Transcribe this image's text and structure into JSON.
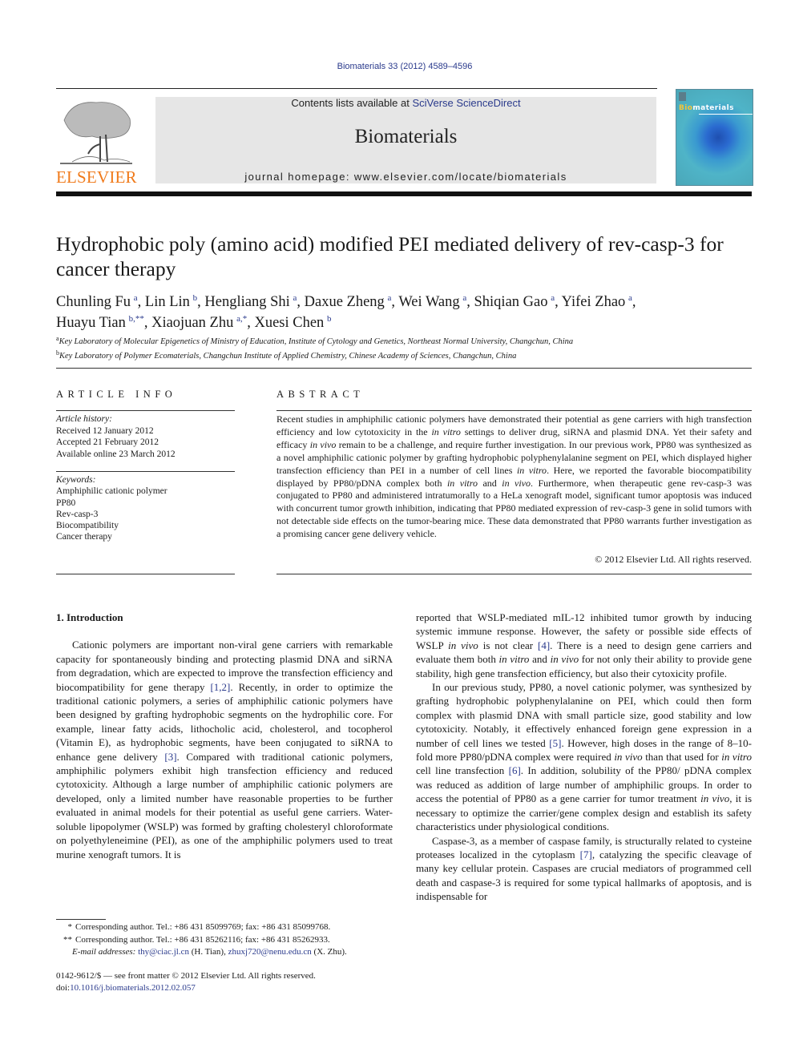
{
  "header": {
    "citation": "Biomaterials 33 (2012) 4589–4596",
    "contents_prefix": "Contents lists available at ",
    "contents_link": "SciVerse ScienceDirect",
    "journal_name": "Biomaterials",
    "homepage": "journal homepage: www.elsevier.com/locate/biomaterials",
    "publisher_logo_text": "ELSEVIER",
    "cover_title_prefix": "Bio",
    "cover_title_suffix": "materials",
    "colors": {
      "publisher_orange": "#f07a1a",
      "link_blue": "#2a3a8c",
      "banner_gray": "#e6e6e6"
    }
  },
  "article": {
    "title": "Hydrophobic poly (amino acid) modified PEI mediated delivery of rev-casp-3 for cancer therapy",
    "authors": [
      {
        "name": "Chunling Fu",
        "sup": "a",
        "sep": ", "
      },
      {
        "name": "Lin Lin",
        "sup": "b",
        "sep": ", "
      },
      {
        "name": "Hengliang Shi",
        "sup": "a",
        "sep": ", "
      },
      {
        "name": "Daxue Zheng",
        "sup": "a",
        "sep": ", "
      },
      {
        "name": "Wei Wang",
        "sup": "a",
        "sep": ", "
      },
      {
        "name": "Shiqian Gao",
        "sup": "a",
        "sep": ", "
      },
      {
        "name": "Yifei Zhao",
        "sup": "a",
        "sep": ","
      },
      {
        "name": "Huayu Tian",
        "sup": "b,**",
        "sep": ", "
      },
      {
        "name": "Xiaojuan Zhu",
        "sup": "a,*",
        "sep": ", "
      },
      {
        "name": "Xuesi Chen",
        "sup": "b",
        "sep": ""
      }
    ],
    "affiliations": [
      {
        "mark": "a",
        "text": "Key Laboratory of Molecular Epigenetics of Ministry of Education, Institute of Cytology and Genetics, Northeast Normal University, Changchun, China"
      },
      {
        "mark": "b",
        "text": "Key Laboratory of Polymer Ecomaterials, Changchun Institute of Applied Chemistry, Chinese Academy of Sciences, Changchun, China"
      }
    ]
  },
  "article_info": {
    "heading": "ARTICLE INFO",
    "history_label": "Article history:",
    "history": [
      "Received 12 January 2012",
      "Accepted 21 February 2012",
      "Available online 23 March 2012"
    ],
    "keywords_label": "Keywords:",
    "keywords": [
      "Amphiphilic cationic polymer",
      "PP80",
      "Rev-casp-3",
      "Biocompatibility",
      "Cancer therapy"
    ]
  },
  "abstract": {
    "heading": "ABSTRACT",
    "segments": [
      {
        "t": "Recent studies in amphiphilic cationic polymers have demonstrated their potential as gene carriers with high transfection efficiency and low cytotoxicity in the "
      },
      {
        "t": "in vitro",
        "i": true
      },
      {
        "t": " settings to deliver drug, siRNA and plasmid DNA. Yet their safety and efficacy "
      },
      {
        "t": "in vivo",
        "i": true
      },
      {
        "t": " remain to be a challenge, and require further investigation. In our previous work, PP80 was synthesized as a novel amphiphilic cationic polymer by grafting hydro­phobic polyphenylalanine segment on PEI, which displayed higher transfection efficiency than PEI in a number of cell lines "
      },
      {
        "t": "in vitro",
        "i": true
      },
      {
        "t": ". Here, we reported the favorable biocompatibility displayed by PP80/pDNA complex both "
      },
      {
        "t": "in vitro",
        "i": true
      },
      {
        "t": " and "
      },
      {
        "t": "in vivo",
        "i": true
      },
      {
        "t": ". Furthermore, when therapeutic gene rev-casp-3 was conjugated to PP80 and administered intratumorally to a HeLa xenograft model, significant tumor apoptosis was induced with concurrent tumor growth inhibition, indicating that PP80 mediated expression of rev-casp-3 gene in solid tumors with not detectable side effects on the tumor-bearing mice. These data demon­strated that PP80 warrants further investigation as a promising cancer gene delivery vehicle."
      }
    ],
    "copyright": "© 2012 Elsevier Ltd. All rights reserved."
  },
  "body": {
    "section_heading": "1.  Introduction",
    "left_paragraphs": [
      {
        "indent": true,
        "segments": [
          {
            "t": "Cationic polymers are important non-viral gene carriers with remarkable capacity for spontaneously binding and protecting plasmid DNA and siRNA from degradation, which are expected to improve the transfection efficiency and biocompatibility for gene therapy "
          },
          {
            "t": "[1,2]",
            "link": true
          },
          {
            "t": ". Recently, in order to optimize the traditional cationic polymers, a series of amphiphilic cationic polymers have been designed by grafting hydrophobic segments on the hydrophilic core. For example, linear fatty acids, lithocholic acid, cholesterol, and tocopherol (Vitamin E), as hydrophobic segments, have been conjugated to siRNA to enhance gene delivery "
          },
          {
            "t": "[3]",
            "link": true
          },
          {
            "t": ". Compared with traditional cationic polymers, amphiphilic polymers exhibit high transfection efficiency and reduced cytotoxicity. Although a large number of amphiphilic cationic polymers are developed, only a limited number have reasonable properties to be further evalu­ated in animal models for their potential as useful gene carriers. Water-soluble lipopolymer (WSLP) was formed by grafting cho­lesteryl chloroformate on polyethyleneimine (PEI), as one of the amphiphilic polymers used to treat murine xenograft tumors. It is"
          }
        ]
      }
    ],
    "right_paragraphs": [
      {
        "indent": false,
        "segments": [
          {
            "t": "reported that WSLP-mediated mIL-12 inhibited tumor growth by inducing systemic immune response. However, the safety or possible side effects of WSLP "
          },
          {
            "t": "in vivo",
            "i": true
          },
          {
            "t": " is not clear "
          },
          {
            "t": "[4]",
            "link": true
          },
          {
            "t": ". There is a need to design gene carriers and evaluate them both "
          },
          {
            "t": "in vitro",
            "i": true
          },
          {
            "t": " and "
          },
          {
            "t": "in vivo",
            "i": true
          },
          {
            "t": " for not only their ability to provide gene stability, high gene transfection efficiency, but also their cytoxicity profile."
          }
        ]
      },
      {
        "indent": true,
        "segments": [
          {
            "t": "In our previous study, PP80, a novel cationic polymer, was synthesized by grafting hydrophobic polyphenylalanine on PEI, which could then form complex with plasmid DNA with small particle size, good stability and low cytotoxicity. Notably, it effec­tively enhanced foreign gene expression in a number of cell lines we tested "
          },
          {
            "t": "[5]",
            "link": true
          },
          {
            "t": ". However, high doses in the range of 8–10-fold more PP80/pDNA complex were required "
          },
          {
            "t": "in vivo",
            "i": true
          },
          {
            "t": " than that used for "
          },
          {
            "t": "in vitro",
            "i": true
          },
          {
            "t": " cell line transfection "
          },
          {
            "t": "[6]",
            "link": true
          },
          {
            "t": ". In addition, solubility of the PP80/ pDNA complex was reduced as addition of large number of amphiphilic groups. In order to access the potential of PP80 as a gene carrier for tumor treatment "
          },
          {
            "t": "in vivo",
            "i": true
          },
          {
            "t": ", it is necessary to opti­mize the carrier/gene complex design and establish its safety characteristics under physiological conditions."
          }
        ]
      },
      {
        "indent": true,
        "segments": [
          {
            "t": "Caspase-3, as a member of caspase family, is structurally related to cysteine proteases localized in the cytoplasm "
          },
          {
            "t": "[7]",
            "link": true
          },
          {
            "t": ", catalyzing the specific cleavage of many key cellular protein. Caspases are crucial mediators of programmed cell death and caspase-3 is required for some typical hallmarks of apoptosis, and is indispensable for"
          }
        ]
      }
    ]
  },
  "footnotes": {
    "corresponding": [
      {
        "mark": "*",
        "text": "Corresponding author. Tel.: +86 431 85099769; fax: +86 431 85099768."
      },
      {
        "mark": "**",
        "text": "Corresponding author. Tel.: +86 431 85262116; fax: +86 431 85262933."
      }
    ],
    "email_label": "E-mail addresses:",
    "emails": [
      {
        "address": "thy@ciac.jl.cn",
        "owner": "(H. Tian)"
      },
      {
        "address": "zhuxj720@nenu.edu.cn",
        "owner": "(X. Zhu)"
      }
    ],
    "front_matter": "0142-9612/$ — see front matter © 2012 Elsevier Ltd. All rights reserved.",
    "doi_prefix": "doi:",
    "doi": "10.1016/j.biomaterials.2012.02.057"
  }
}
